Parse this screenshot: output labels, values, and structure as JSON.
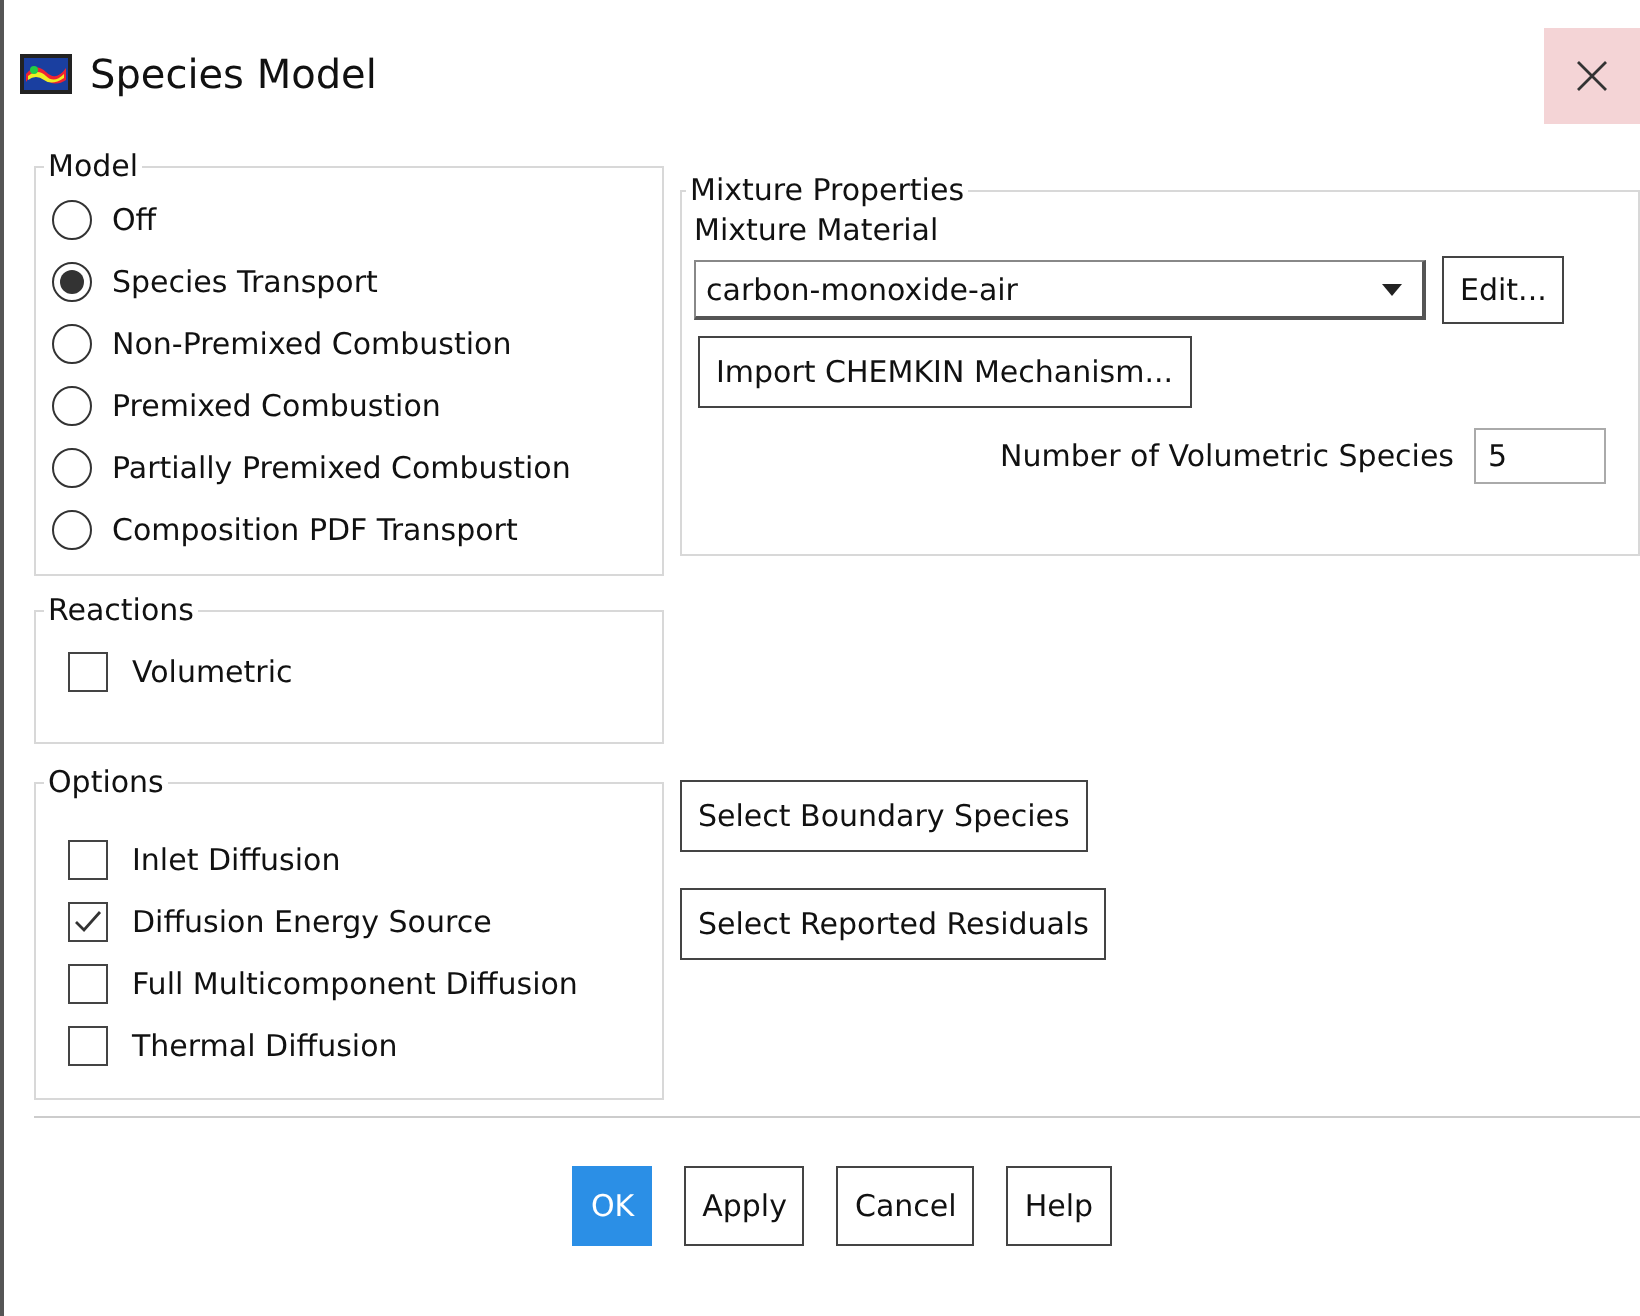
{
  "window": {
    "title": "Species Model"
  },
  "model": {
    "label": "Model",
    "options": [
      {
        "label": "Off",
        "selected": false
      },
      {
        "label": "Species Transport",
        "selected": true
      },
      {
        "label": "Non-Premixed Combustion",
        "selected": false
      },
      {
        "label": "Premixed Combustion",
        "selected": false
      },
      {
        "label": "Partially Premixed Combustion",
        "selected": false
      },
      {
        "label": "Composition PDF Transport",
        "selected": false
      }
    ]
  },
  "reactions": {
    "label": "Reactions",
    "items": [
      {
        "label": "Volumetric",
        "checked": false
      }
    ]
  },
  "options": {
    "label": "Options",
    "items": [
      {
        "label": "Inlet Diffusion",
        "checked": false
      },
      {
        "label": "Diffusion Energy Source",
        "checked": true
      },
      {
        "label": "Full Multicomponent Diffusion",
        "checked": false
      },
      {
        "label": "Thermal Diffusion",
        "checked": false
      }
    ]
  },
  "mixture": {
    "label": "Mixture Properties",
    "material_label": "Mixture Material",
    "material_value": "carbon-monoxide-air",
    "edit_button": "Edit...",
    "import_button": "Import CHEMKIN Mechanism...",
    "species_label": "Number of Volumetric Species",
    "species_value": "5"
  },
  "side_buttons": [
    "Select Boundary Species",
    "Select Reported Residuals"
  ],
  "buttons": [
    {
      "label": "OK",
      "default": true
    },
    {
      "label": "Apply",
      "default": false
    },
    {
      "label": "Cancel",
      "default": false
    },
    {
      "label": "Help",
      "default": false
    }
  ]
}
